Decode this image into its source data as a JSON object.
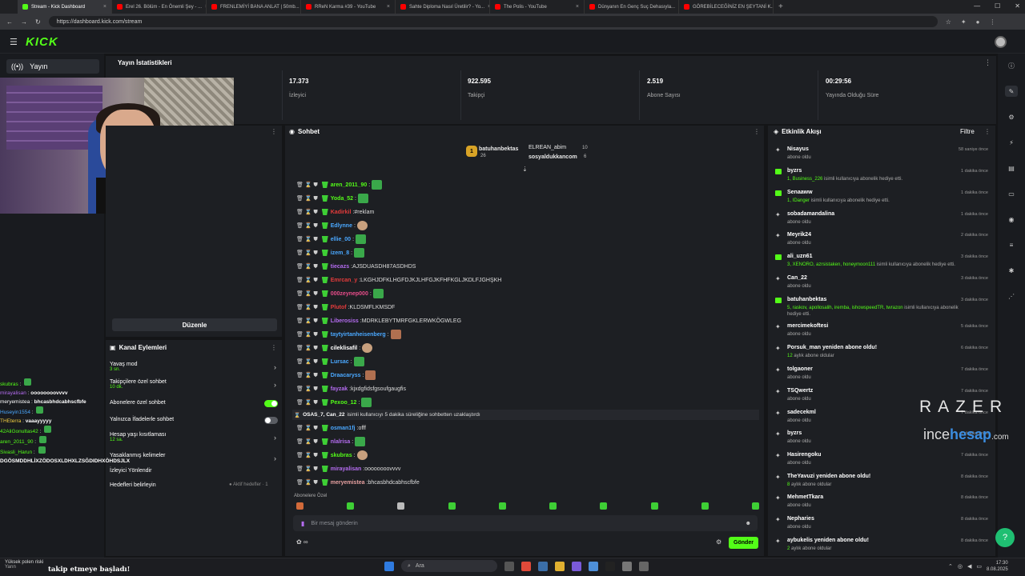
{
  "browser": {
    "tabs": [
      {
        "title": "Stream - Kick Dashboard",
        "active": true,
        "icon": "kick-icon"
      },
      {
        "title": "Erel 26. Bölüm - En Önemli Şey - ...",
        "icon": "youtube-icon"
      },
      {
        "title": "FRENLEMİYİ BANA ANLAT | 50mb...",
        "icon": "youtube-icon"
      },
      {
        "title": "RReN Karma #39 - YouTube",
        "icon": "youtube-icon"
      },
      {
        "title": "Sahte Diploma Nasıl Üretilir? - Yo...",
        "icon": "youtube-icon"
      },
      {
        "title": "The Polis - YouTube",
        "icon": "youtube-icon"
      },
      {
        "title": "Dünyanın En Genç Suç Dehasıyla...",
        "icon": "youtube-icon"
      },
      {
        "title": "GÖREBİLECEĞİNİZ EN ŞEYTANİ K...",
        "icon": "youtube-icon"
      }
    ],
    "url": "https://dashboard.kick.com/stream"
  },
  "brand": {
    "logo": "KICK",
    "accent": "#53fc18"
  },
  "nav": {
    "yayin_label": "Yayın"
  },
  "stats": {
    "title": "Yayın İstatistikleri",
    "items": [
      {
        "value": "17.373",
        "label": "İzleyici"
      },
      {
        "value": "922.595",
        "label": "Takipçi"
      },
      {
        "value": "2.519",
        "label": "Abone Sayısı"
      },
      {
        "value": "00:29:56",
        "label": "Yayında Olduğu Süre"
      }
    ]
  },
  "left_panel": {
    "edit_label": "Düzenle"
  },
  "channel_actions": {
    "title": "Kanal Eylemleri",
    "items": [
      {
        "label": "Yavaş mod",
        "sub": "3 sn.",
        "control": "chevron"
      },
      {
        "label": "Takipçilere özel sohbet",
        "sub": "10 dk.",
        "control": "chevron"
      },
      {
        "label": "Abonelere özel sohbet",
        "sub": "",
        "control": "toggle-on"
      },
      {
        "label": "Yalnızca İfadelerle sohbet",
        "sub": "",
        "control": "toggle-off"
      },
      {
        "label": "Hesap yaşı kısıtlaması",
        "sub": "12 sa.",
        "control": "chevron"
      },
      {
        "label": "Yasaklanmış kelimeler",
        "sub": "",
        "control": "chevron"
      },
      {
        "label": "İzleyici Yönlendir",
        "sub": "",
        "control": "none"
      },
      {
        "label": "Hedefleri belirleyin",
        "sub": "",
        "control": "none"
      }
    ],
    "goals_note": "● Aktif hedefler · 1"
  },
  "overlay_chat": [
    {
      "user": "skubras",
      "text": "",
      "color": "#53fc18"
    },
    {
      "user": "mirayalisan",
      "text": "oooooooovvvv",
      "color": "#b46cf0"
    },
    {
      "user": "meryemistea",
      "text": "bhcasbhdcabhscfbfe",
      "color": "#ffffff"
    },
    {
      "user": "Huseyin1554",
      "text": "",
      "color": "#4aa8ff"
    },
    {
      "user": "THEterra",
      "text": "vaaayyyyy",
      "color": "#f5d142"
    },
    {
      "user": "42AliGonultas42",
      "text": "",
      "color": "#53fc18"
    },
    {
      "user": "aren_2011_90",
      "text": "",
      "color": "#53fc18"
    },
    {
      "user": "Sivasli_Harun",
      "text": "",
      "color": "#53fc18"
    },
    {
      "user": "",
      "text": "DGÖSMDDHLİXZÖDOSXLDHXLZSĞDIDHXÖHDSJLX",
      "color": "#ffffff"
    }
  ],
  "chat": {
    "title": "Sohbet",
    "pinned": [
      {
        "name": "batuhanbektas",
        "count": "26",
        "color": "#e6b84a"
      },
      {
        "name": "ELREAN_abim",
        "count": "10",
        "color": "#cccccc"
      },
      {
        "name": "sosyaldukkancom",
        "count": "6",
        "color": "#e6b84a"
      }
    ],
    "messages": [
      {
        "user": "aren_2011_90",
        "text": "",
        "color": "#53fc18",
        "emote": "emote"
      },
      {
        "user": "Yoda_52",
        "text": "",
        "color": "#53fc18",
        "emote": "emote"
      },
      {
        "user": "Kadirkil",
        "text": "#reklam",
        "color": "#e33b3b",
        "emote": ""
      },
      {
        "user": "Edlynne",
        "text": "",
        "color": "#4aa8ff",
        "emote": "face"
      },
      {
        "user": "ellie_00",
        "text": "",
        "color": "#4aa8ff",
        "emote": "emote"
      },
      {
        "user": "izem_8",
        "text": "",
        "color": "#4aa8ff",
        "emote": "emote"
      },
      {
        "user": "tiecazs",
        "text": "AJSDUASDH87ASDHDS",
        "color": "#b46cf0",
        "emote": ""
      },
      {
        "user": "Emrcan_y",
        "text": "LKGHJDFKLHGFDJKJLHFGJKFHFKGLJKDLFJGHŞKH",
        "color": "#e33b3b",
        "emote": ""
      },
      {
        "user": "000zeynep000",
        "text": "",
        "color": "#e74c8a",
        "emote": "emote"
      },
      {
        "user": "Plutof",
        "text": "KLDSMFLKMSDF",
        "color": "#e33b3b",
        "emote": ""
      },
      {
        "user": "Liberosiss",
        "text": "MDRKLEBYTMRFGKLERWKÖGWLEG",
        "color": "#b46cf0",
        "emote": ""
      },
      {
        "user": "taytyirtanheisenberg",
        "text": "",
        "color": "#4aa8ff",
        "emote": "pic"
      },
      {
        "user": "cileklisafil",
        "text": "",
        "color": "#ffffff",
        "emote": "face"
      },
      {
        "user": "Lursac",
        "text": "",
        "color": "#4aa8ff",
        "emote": "emote"
      },
      {
        "user": "Draacaryss",
        "text": "",
        "color": "#4aa8ff",
        "emote": "pic"
      },
      {
        "user": "fayzak",
        "text": "kjxdgfidsfgsoufgaugfis",
        "color": "#b46cf0",
        "emote": ""
      },
      {
        "user": "Pexoo_12",
        "text": "",
        "color": "#53fc18",
        "emote": "emote"
      },
      {
        "user": "osman1fj",
        "text": "offf",
        "color": "#4aa8ff",
        "emote": ""
      },
      {
        "user": "nlalrisa",
        "text": "",
        "color": "#b46cf0",
        "emote": "emote"
      },
      {
        "user": "skubras",
        "text": "",
        "color": "#53fc18",
        "emote": "face"
      },
      {
        "user": "mirayalisan",
        "text": "oooooooovvvv",
        "color": "#b46cf0",
        "emote": ""
      },
      {
        "user": "meryemistea",
        "text": "bhcasbhdcabhscfbfe",
        "color": "#e6a0a0",
        "emote": ""
      }
    ],
    "system": {
      "user": "OSAS_7, Can_22",
      "text": "isimli kullanıcıyı 5 dakika süreliğine sohbetten uzaklaştırdı"
    },
    "sub_label": "Abonelere Özel",
    "placeholder": "Bir mesaj gönderin",
    "send_label": "Gönder"
  },
  "activity": {
    "title": "Etkinlik Akışı",
    "filter_label": "Filtre",
    "events": [
      {
        "name": "Nisayus",
        "desc": "abone oldu",
        "time": "58 saniye önce",
        "icon": "star-icon"
      },
      {
        "name": "byzrs",
        "desc_hl": "1, Business_226",
        "desc": "isimli kullanıcıya abonelik hediye etti.",
        "time": "1 dakika önce",
        "icon": "gift-icon"
      },
      {
        "name": "Senaaww",
        "desc_hl": "1, IDanger",
        "desc": "isimli kullanıcıya abonelik hediye etti.",
        "time": "1 dakika önce",
        "icon": "gift-icon"
      },
      {
        "name": "sobadamandalina",
        "desc": "abone oldu",
        "time": "1 dakika önce",
        "icon": "star-icon"
      },
      {
        "name": "Meyrik24",
        "desc": "abone oldu",
        "time": "2 dakika önce",
        "icon": "star-icon"
      },
      {
        "name": "ali_uzn61",
        "desc_hl": "3, XENORO, azrsistaken, honeymoon111",
        "desc": "isimli kullanıcıya abonelik hediye etti.",
        "time": "3 dakika önce",
        "icon": "gift-icon"
      },
      {
        "name": "Can_22",
        "desc": "abone oldu",
        "time": "3 dakika önce",
        "icon": "star-icon"
      },
      {
        "name": "batuhanbektas",
        "desc_hl": "5, raskov, apollosalih, iremba, ishowspeedTR, twrazon",
        "desc": "isimli kullanıcıya abonelik hediye etti.",
        "time": "3 dakika önce",
        "icon": "gift-icon"
      },
      {
        "name": "mercimekoftesi",
        "desc": "abone oldu",
        "time": "5 dakika önce",
        "icon": "star-icon"
      },
      {
        "name": "Porsuk_man yeniden abone oldu!",
        "desc_hl": "12",
        "desc": "aylık abone oldular",
        "time": "6 dakika önce",
        "icon": "star-icon"
      },
      {
        "name": "tolgaoner",
        "desc": "abone oldu",
        "time": "7 dakika önce",
        "icon": "star-icon"
      },
      {
        "name": "TSQwertz",
        "desc": "abone oldu",
        "time": "7 dakika önce",
        "icon": "star-icon"
      },
      {
        "name": "sadecekml",
        "desc": "abone oldu",
        "time": "7 dakika önce",
        "icon": "star-icon"
      },
      {
        "name": "byzrs",
        "desc": "abone oldu",
        "time": "7 dakika önce",
        "icon": "star-icon"
      },
      {
        "name": "Hasirengoku",
        "desc": "abone oldu",
        "time": "7 dakika önce",
        "icon": "star-icon"
      },
      {
        "name": "TheYavuzi yeniden abone oldu!",
        "desc_hl": "8",
        "desc": "aylık abone oldular",
        "time": "8 dakika önce",
        "icon": "star-icon"
      },
      {
        "name": "MehmetTkara",
        "desc": "abone oldu",
        "time": "8 dakika önce",
        "icon": "star-icon"
      },
      {
        "name": "Nepharies",
        "desc": "abone oldu",
        "time": "8 dakika önce",
        "icon": "star-icon"
      },
      {
        "name": "aybukelis yeniden abone oldu!",
        "desc_hl": "2",
        "desc": "aylık abone oldular",
        "time": "8 dakika önce",
        "icon": "star-icon"
      }
    ]
  },
  "sponsors": {
    "razer": "RAZER",
    "incehesap_a": "ince",
    "incehesap_b": "hesap",
    "incehesap_c": ".com"
  },
  "taskbar": {
    "weather_title": "Yüksek polen riski",
    "weather_sub": "Yarın",
    "overlay_follow": "takip etmeye başladı!",
    "search_label": "Ara",
    "time": "17:30",
    "date": "8.08.2025"
  }
}
